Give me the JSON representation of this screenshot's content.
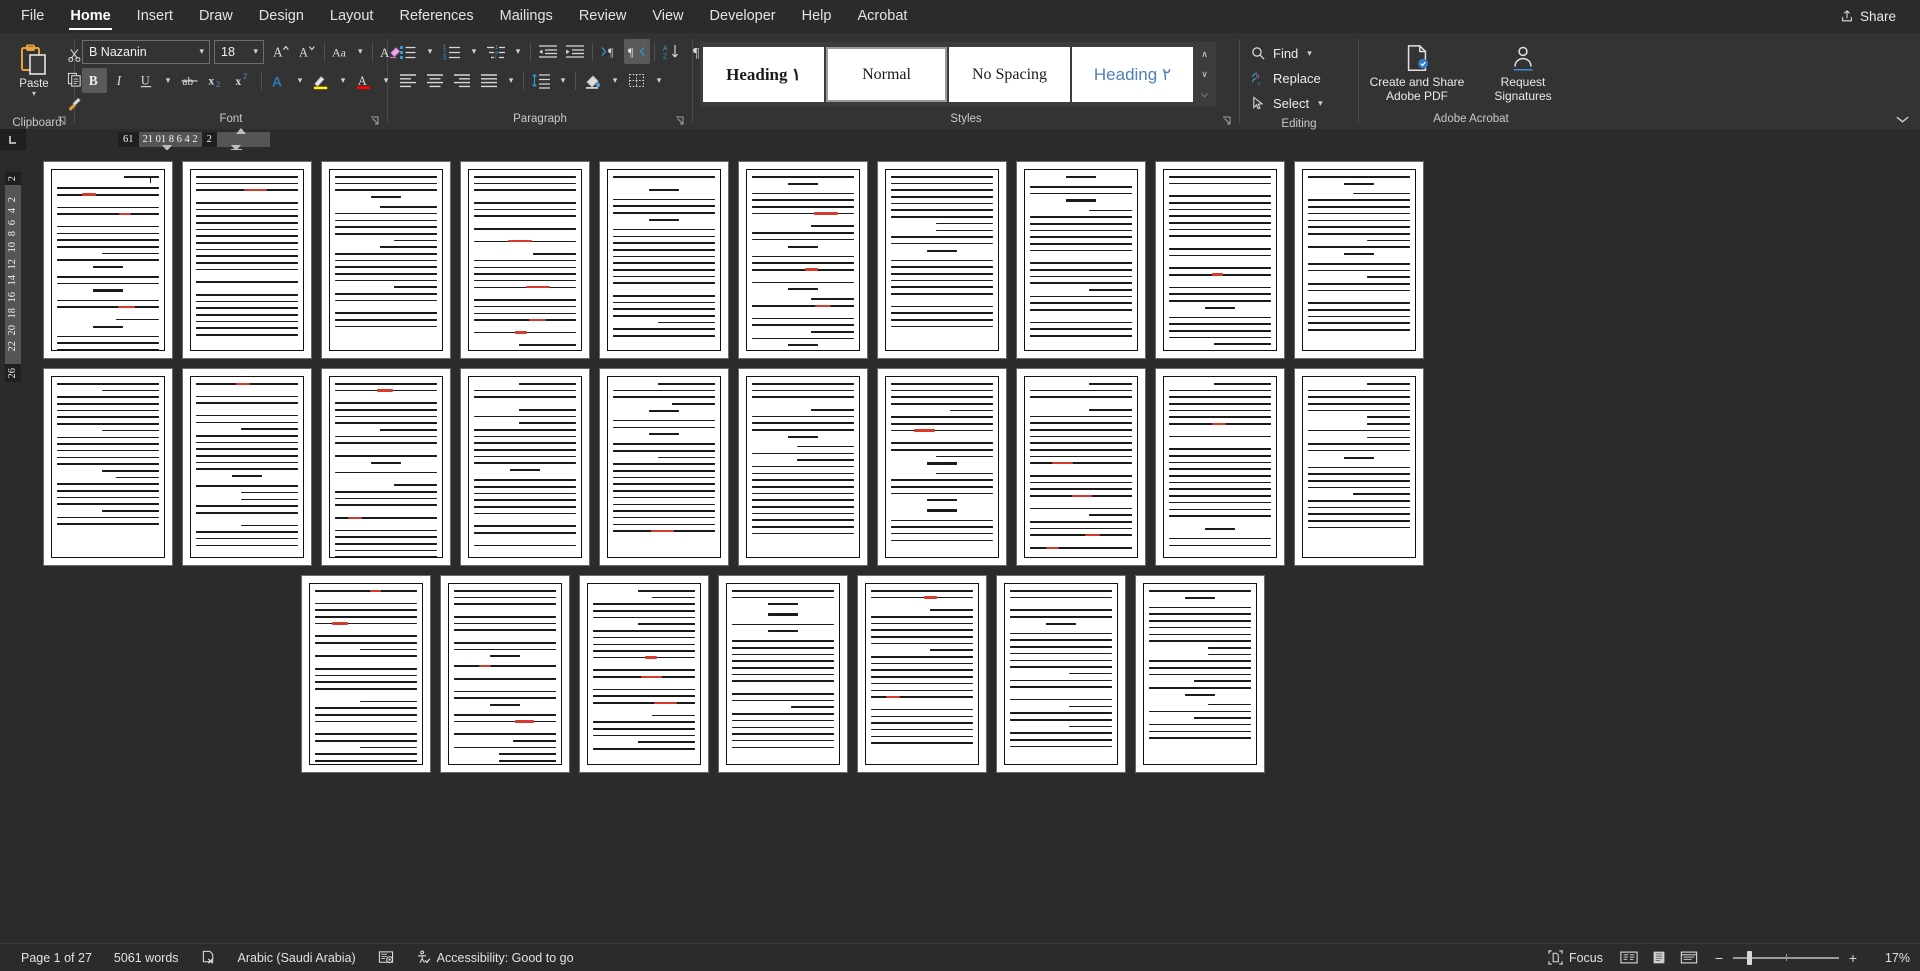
{
  "app": {
    "theme_bg": "#2b2b2b",
    "ribbon_bg": "#333333",
    "accent": "#4f81bd"
  },
  "tabs": [
    {
      "label": "File",
      "active": false
    },
    {
      "label": "Home",
      "active": true
    },
    {
      "label": "Insert",
      "active": false
    },
    {
      "label": "Draw",
      "active": false
    },
    {
      "label": "Design",
      "active": false
    },
    {
      "label": "Layout",
      "active": false
    },
    {
      "label": "References",
      "active": false
    },
    {
      "label": "Mailings",
      "active": false
    },
    {
      "label": "Review",
      "active": false
    },
    {
      "label": "View",
      "active": false
    },
    {
      "label": "Developer",
      "active": false
    },
    {
      "label": "Help",
      "active": false
    },
    {
      "label": "Acrobat",
      "active": false
    }
  ],
  "share": {
    "label": "Share",
    "icon": "share-icon"
  },
  "ribbon": {
    "groups": [
      {
        "name": "clipboard",
        "label": "Clipboard"
      },
      {
        "name": "font",
        "label": "Font"
      },
      {
        "name": "paragraph",
        "label": "Paragraph"
      },
      {
        "name": "styles",
        "label": "Styles"
      },
      {
        "name": "editing",
        "label": "Editing"
      },
      {
        "name": "acrobat",
        "label": "Adobe Acrobat"
      }
    ],
    "clipboard": {
      "paste_label": "Paste",
      "cut_icon": "scissors-icon",
      "copy_icon": "copy-icon",
      "format_painter_icon": "format-painter-icon"
    },
    "font": {
      "font_name": "B Nazanin",
      "font_size": "18",
      "grow_font": "A^",
      "shrink_font": "Av",
      "change_case": "Aa",
      "clear_formatting": "clear-formatting-icon",
      "bold": "B",
      "italic": "I",
      "underline": "U",
      "strikethrough": "ab",
      "subscript": "x₂",
      "superscript": "x²",
      "text_effects": "A",
      "highlight": "highlight-icon",
      "font_color": "A"
    },
    "paragraph": {
      "bullets": "bullets-icon",
      "numbering": "numbering-icon",
      "multilevel": "multilevel-list-icon",
      "decrease_indent": "decrease-indent-icon",
      "increase_indent": "increase-indent-icon",
      "ltr": "left-to-right-icon",
      "rtl": "right-to-left-icon",
      "sort": "sort-icon",
      "show_marks": "pilcrow-icon",
      "align_left": "align-left-icon",
      "align_center": "align-center-icon",
      "align_right": "align-right-icon",
      "justify": "justify-icon",
      "line_spacing": "line-spacing-icon",
      "shading": "shading-icon",
      "borders": "borders-icon"
    },
    "styles": {
      "items": [
        {
          "label": "Heading ١",
          "kind": "h1",
          "selected": false
        },
        {
          "label": "Normal",
          "kind": "normal",
          "selected": true
        },
        {
          "label": "No Spacing",
          "kind": "normal",
          "selected": false
        },
        {
          "label": "Heading ٢",
          "kind": "h2",
          "selected": false
        }
      ],
      "scroll_up": "∧",
      "scroll_down": "∨",
      "more": "⌵"
    },
    "editing": {
      "find": "Find",
      "replace": "Replace",
      "select": "Select"
    },
    "acrobat": {
      "create_share": "Create and Share\nAdobe PDF",
      "create_share_line1": "Create and Share",
      "create_share_line2": "Adobe PDF",
      "request_sign_line1": "Request",
      "request_sign_line2": "Signatures"
    },
    "collapse_icon": "chevron-up-icon"
  },
  "ruler": {
    "tab_stop_marker": "L",
    "horizontal_left": "61",
    "horizontal_numbers": [
      "2",
      "4",
      "6",
      "8",
      "10",
      "12"
    ],
    "horizontal_display": "21 01 8 6 4 2",
    "horizontal_right": "2",
    "vertical_top": "2",
    "vertical_numbers": [
      "2",
      "4",
      "6",
      "8",
      "10",
      "12",
      "14",
      "16",
      "18",
      "20",
      "22"
    ],
    "vertical_bottom": "26"
  },
  "document": {
    "language_direction": "rtl",
    "row1_pages": 10,
    "row2_pages": 10,
    "row3_pages": 7,
    "row3_offset_pages": 2,
    "spell_error_color": "#d63a2f",
    "citation_color": "#1a1a8c"
  },
  "status": {
    "page_info": "Page 1 of 27",
    "word_count": "5061 words",
    "proofing_icon": "proofing-errors-icon",
    "language": "Arabic (Saudi Arabia)",
    "dictation_icon": "dictate-icon",
    "accessibility_icon": "accessibility-icon",
    "accessibility": "Accessibility: Good to go",
    "focus_icon": "focus-icon",
    "focus": "Focus",
    "view_read_icon": "read-mode-icon",
    "view_print_icon": "print-layout-icon",
    "view_web_icon": "web-layout-icon",
    "zoom_out": "−",
    "zoom_in": "+",
    "zoom_level": "17%"
  }
}
